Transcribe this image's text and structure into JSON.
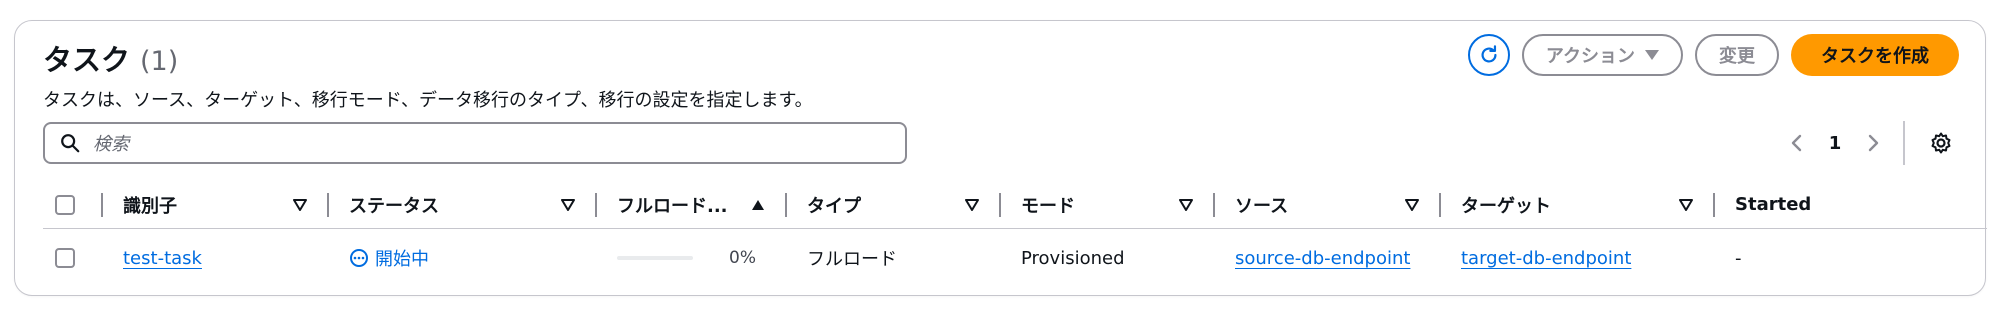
{
  "header": {
    "title": "タスク",
    "count": "(1)",
    "description": "タスクは、ソース、ターゲット、移行モード、データ移行のタイプ、移行の設定を指定します。"
  },
  "actions": {
    "refresh_icon": "refresh-icon",
    "actions_label": "アクション",
    "modify_label": "変更",
    "create_label": "タスクを作成"
  },
  "search": {
    "placeholder": "検索",
    "value": ""
  },
  "pagination": {
    "current_page": "1"
  },
  "table": {
    "columns": [
      "識別子",
      "ステータス",
      "フルロード...",
      "タイプ",
      "モード",
      "ソース",
      "ターゲット",
      "Started"
    ],
    "rows": [
      {
        "identifier": "test-task",
        "status": "開始中",
        "full_load_progress": "0%",
        "full_load_fraction": 0,
        "type": "フルロード",
        "mode": "Provisioned",
        "source": "source-db-endpoint",
        "target": "target-db-endpoint",
        "started": "-"
      }
    ]
  },
  "colors": {
    "primary": "#ff9900",
    "link": "#006ce0",
    "border": "#c6c6cd"
  }
}
